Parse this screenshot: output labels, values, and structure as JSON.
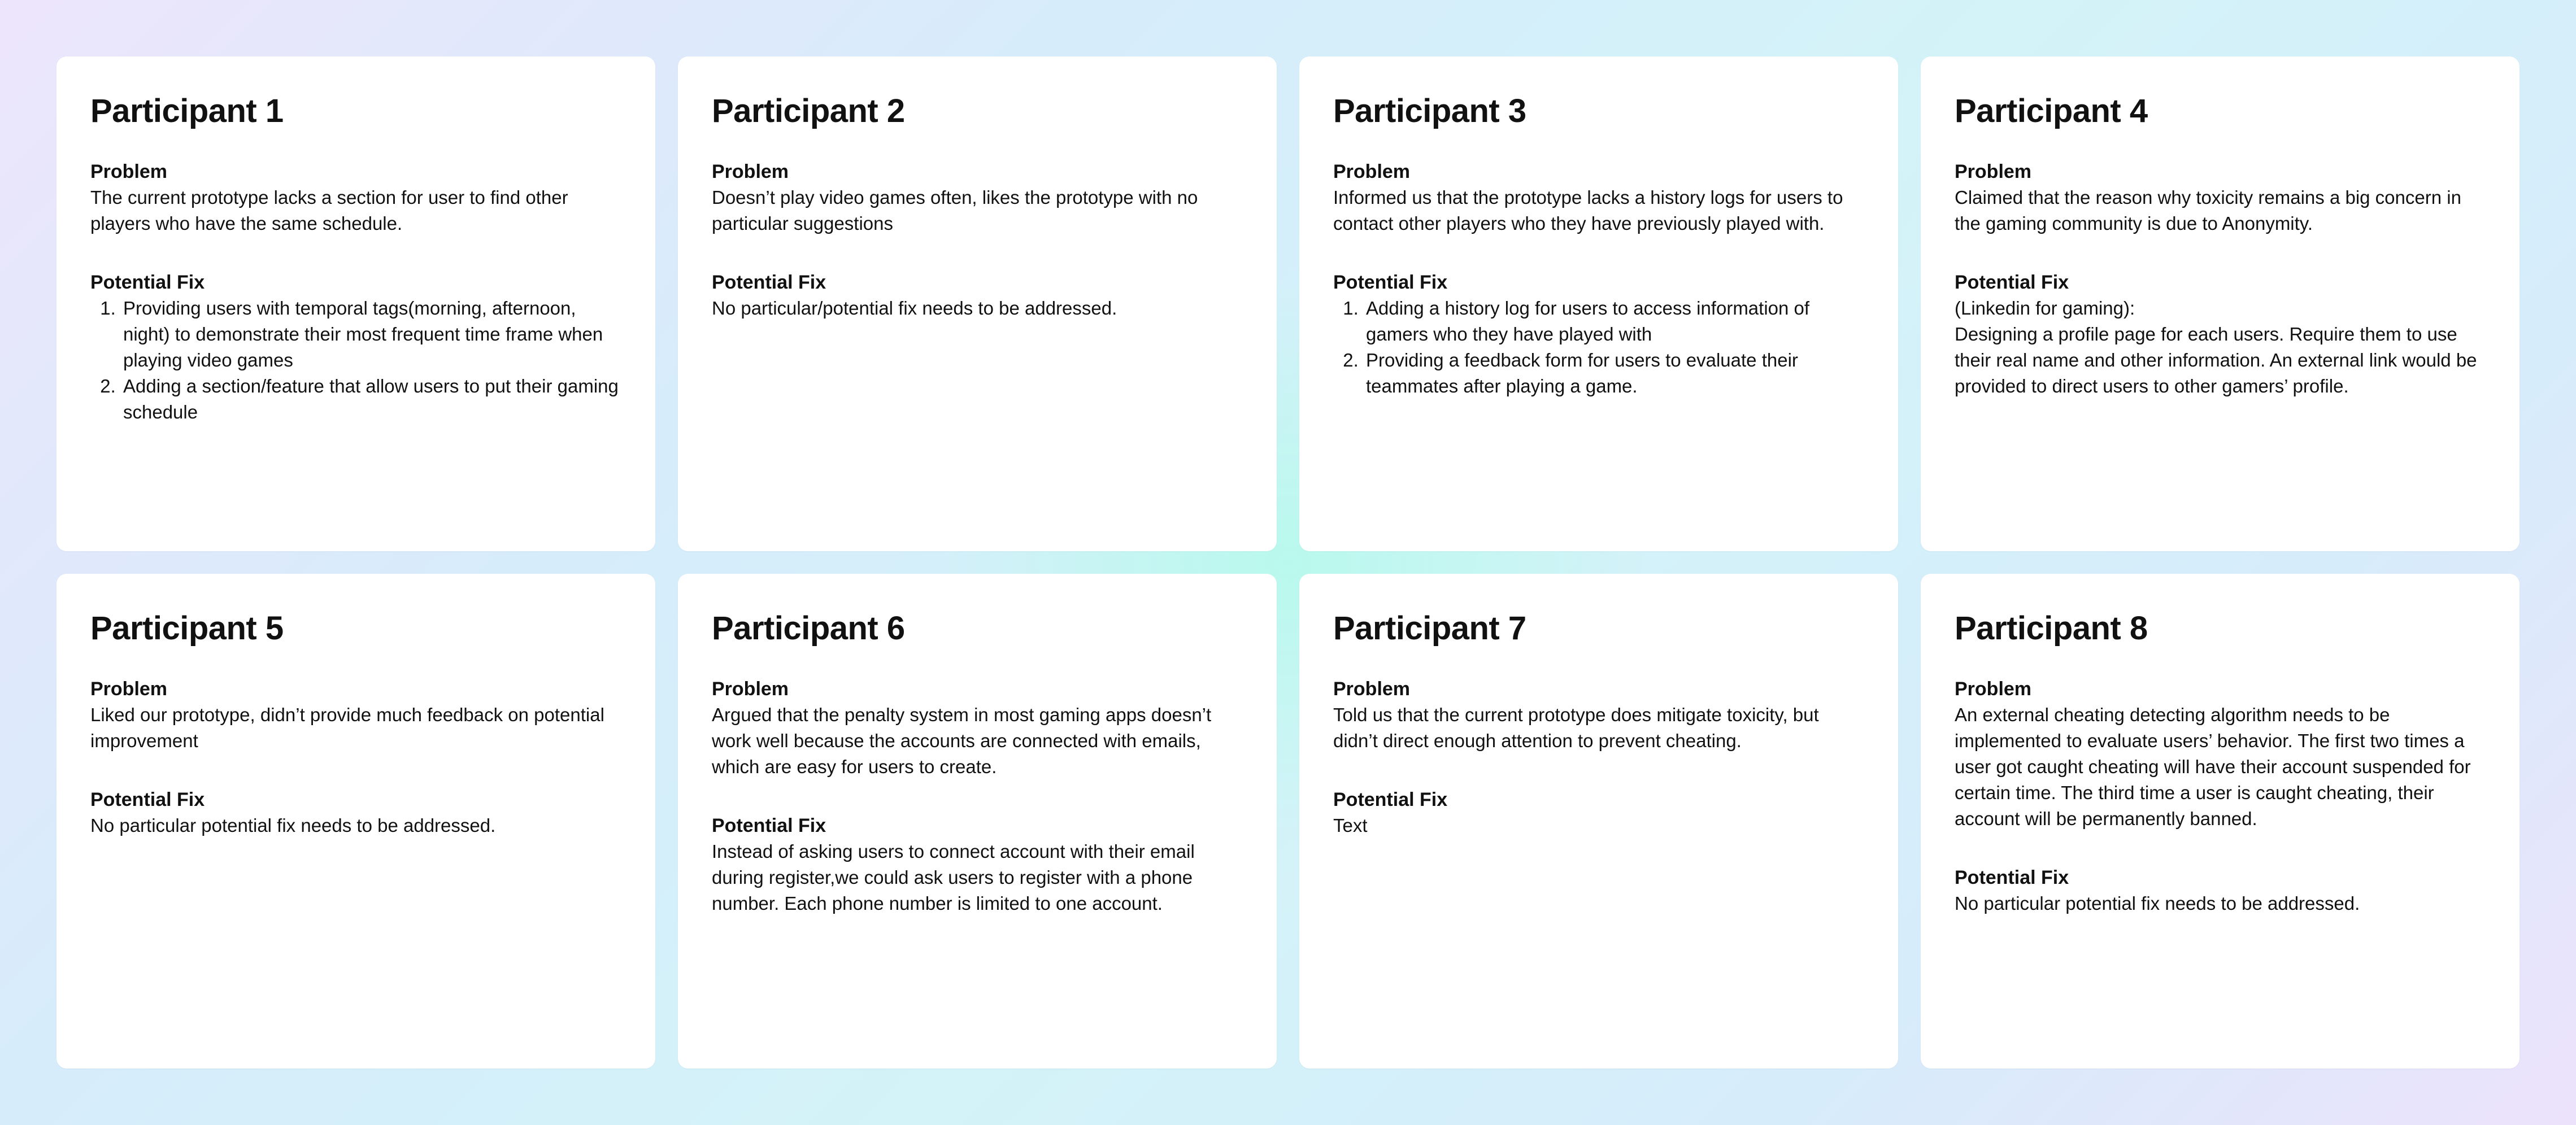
{
  "labels": {
    "problem": "Problem",
    "fix": "Potential Fix"
  },
  "participants": [
    {
      "title": "Participant 1",
      "problem": "The current prototype lacks a section for user to find other players who have the same schedule.",
      "fix_items": [
        "Providing users with temporal tags(morning, afternoon, night) to demonstrate their most frequent time frame when playing video games",
        "Adding a section/feature that allow users to put their gaming schedule"
      ]
    },
    {
      "title": "Participant 2",
      "problem": "Doesn’t play video games often, likes the prototype with no particular suggestions",
      "fix_text": "No particular/potential fix needs to be addressed."
    },
    {
      "title": "Participant 3",
      "problem": "Informed us that the prototype lacks a history logs for users to contact other players who they have previously played with.",
      "fix_items": [
        "Adding a history log for users to access information of gamers who they have played with",
        "Providing a feedback form for users to evaluate their teammates after playing a game."
      ]
    },
    {
      "title": "Participant 4",
      "problem": "Claimed that the reason why toxicity remains a big concern in the gaming community is due to Anonymity.",
      "fix_text": "(Linkedin for gaming):\nDesigning a profile page for each users. Require them to use their real name and other information. An external link would be provided to direct users to other gamers’ profile."
    },
    {
      "title": "Participant 5",
      "problem": "Liked our prototype, didn’t provide much feedback on potential improvement",
      "fix_text": "No particular potential fix needs to be addressed."
    },
    {
      "title": "Participant 6",
      "problem": "Argued that the penalty system in most gaming apps doesn’t work well because the accounts are connected with emails, which are easy for users to create.",
      "fix_text": "Instead of asking users to connect account with their email during register,we could ask users to register with a phone number. Each phone number is limited to one account."
    },
    {
      "title": "Participant 7",
      "problem": "Told us that the current prototype does mitigate toxicity, but didn’t direct enough attention to prevent cheating.",
      "fix_text": "Text"
    },
    {
      "title": "Participant 8",
      "problem": "An external cheating detecting algorithm needs to be implemented to evaluate users’ behavior. The first two times a user got caught cheating will have their account suspended for certain time. The third time a user is caught cheating, their account will be permanently banned.",
      "fix_text": "No particular potential fix needs to be addressed."
    }
  ]
}
